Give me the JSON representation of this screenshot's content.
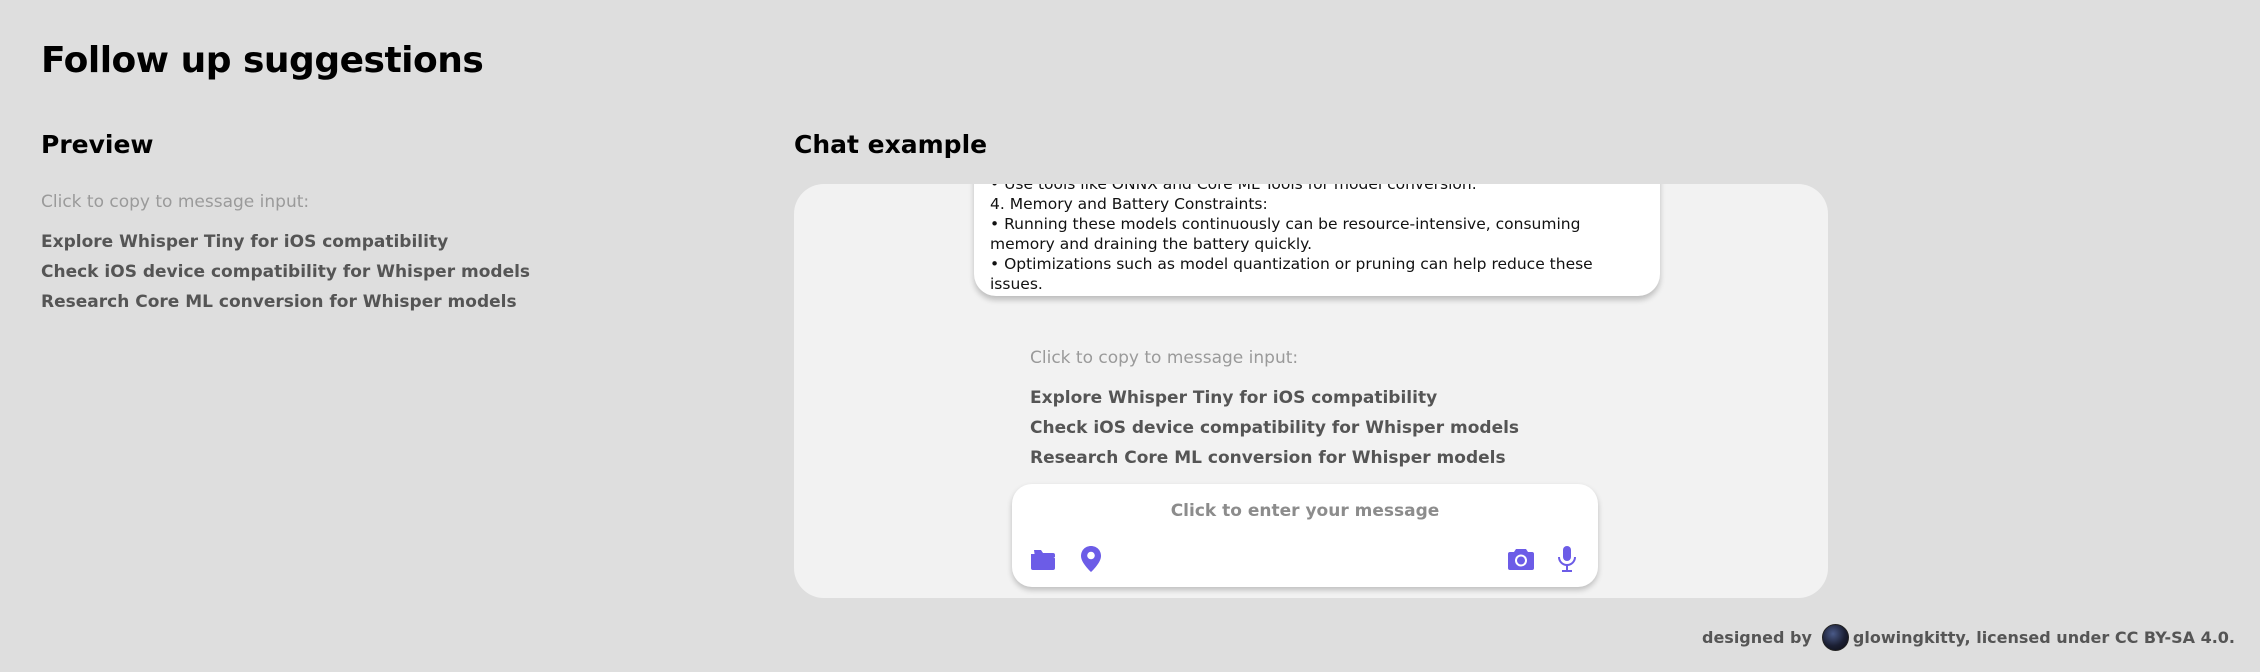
{
  "page": {
    "title": "Follow up suggestions"
  },
  "preview": {
    "title": "Preview",
    "hint": "Click to copy to message input:",
    "suggestions": [
      "Explore Whisper Tiny for iOS compatibility",
      "Check iOS device compatibility for Whisper models",
      "Research Core ML conversion for Whisper models"
    ]
  },
  "chat": {
    "title": "Chat example",
    "message_lines": [
      " • Use tools like ONNX and Core ML Tools for model conversion.",
      " 4. Memory and Battery Constraints:",
      " • Running these models continuously can be resource-intensive, consuming",
      "memory and draining the battery quickly.",
      " • Optimizations such as model quantization or pruning can help reduce these",
      "issues."
    ],
    "hint": "Click to copy to message input:",
    "suggestions": [
      "Explore Whisper Tiny for iOS compatibility",
      "Check iOS device compatibility for Whisper models",
      "Research Core ML conversion for Whisper models"
    ],
    "input": {
      "placeholder": "Click to enter your message",
      "left_icons": [
        "folder-icon",
        "location-pin-icon"
      ],
      "right_icons": [
        "camera-icon",
        "microphone-icon"
      ]
    },
    "accent_color": "#6c5ce7"
  },
  "footer": {
    "designed_by": "designed by",
    "credit": "glowingkitty, licensed under CC BY-SA 4.0."
  }
}
